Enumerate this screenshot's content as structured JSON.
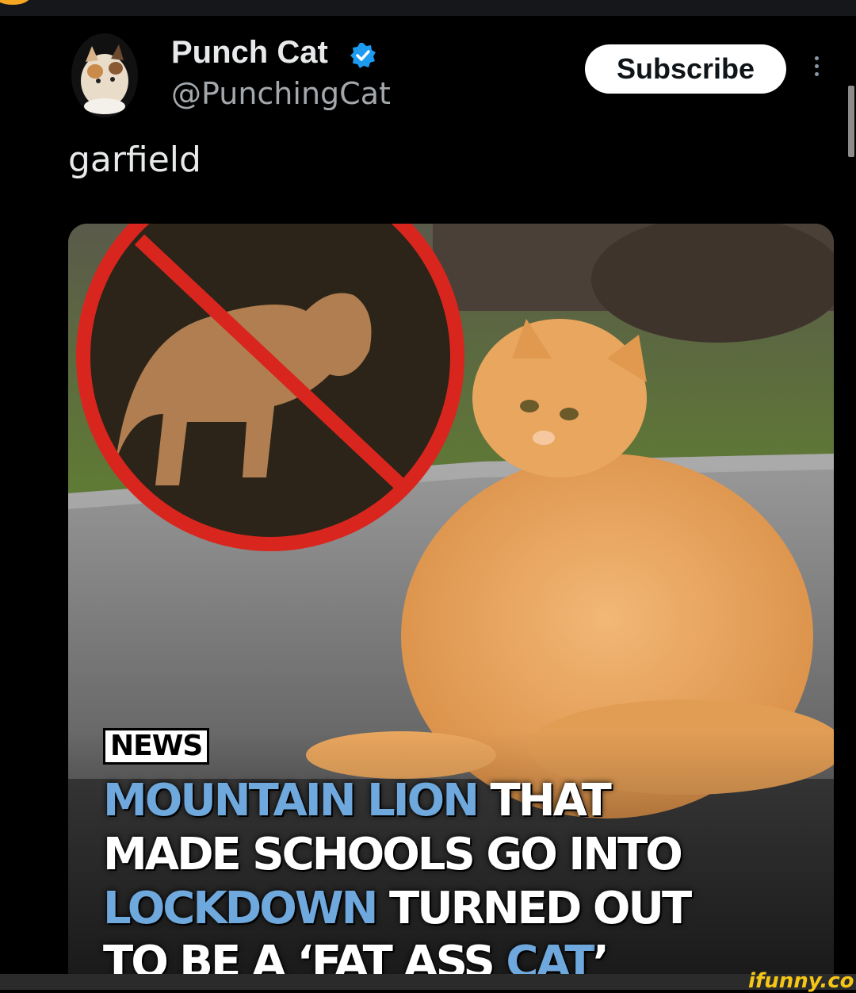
{
  "post": {
    "author_name": "Punch Cat",
    "author_handle": "@PunchingCat",
    "verified_icon": "verified-badge-icon",
    "subscribe_label": "Subscribe",
    "more_icon": "more-vertical-icon",
    "text": "garfield"
  },
  "media": {
    "news_tag": "NEWS",
    "headline": {
      "l1_blue": "MOUNTAIN LION",
      "l1_white": " THAT",
      "l2_white": "MADE SCHOOLS GO INTO",
      "l3_blue": "LOCKDOWN",
      "l3_white": " TURNED OUT",
      "l4_white": "TO BE A ‘FAT ASS ",
      "l4_blue": "CAT",
      "l4_end": "’"
    }
  },
  "watermark": "ifunny.co",
  "colors": {
    "background": "#000000",
    "verified_blue": "#1d9bf0",
    "headline_blue": "#6fa8dc",
    "watermark_yellow": "#f5c518"
  }
}
